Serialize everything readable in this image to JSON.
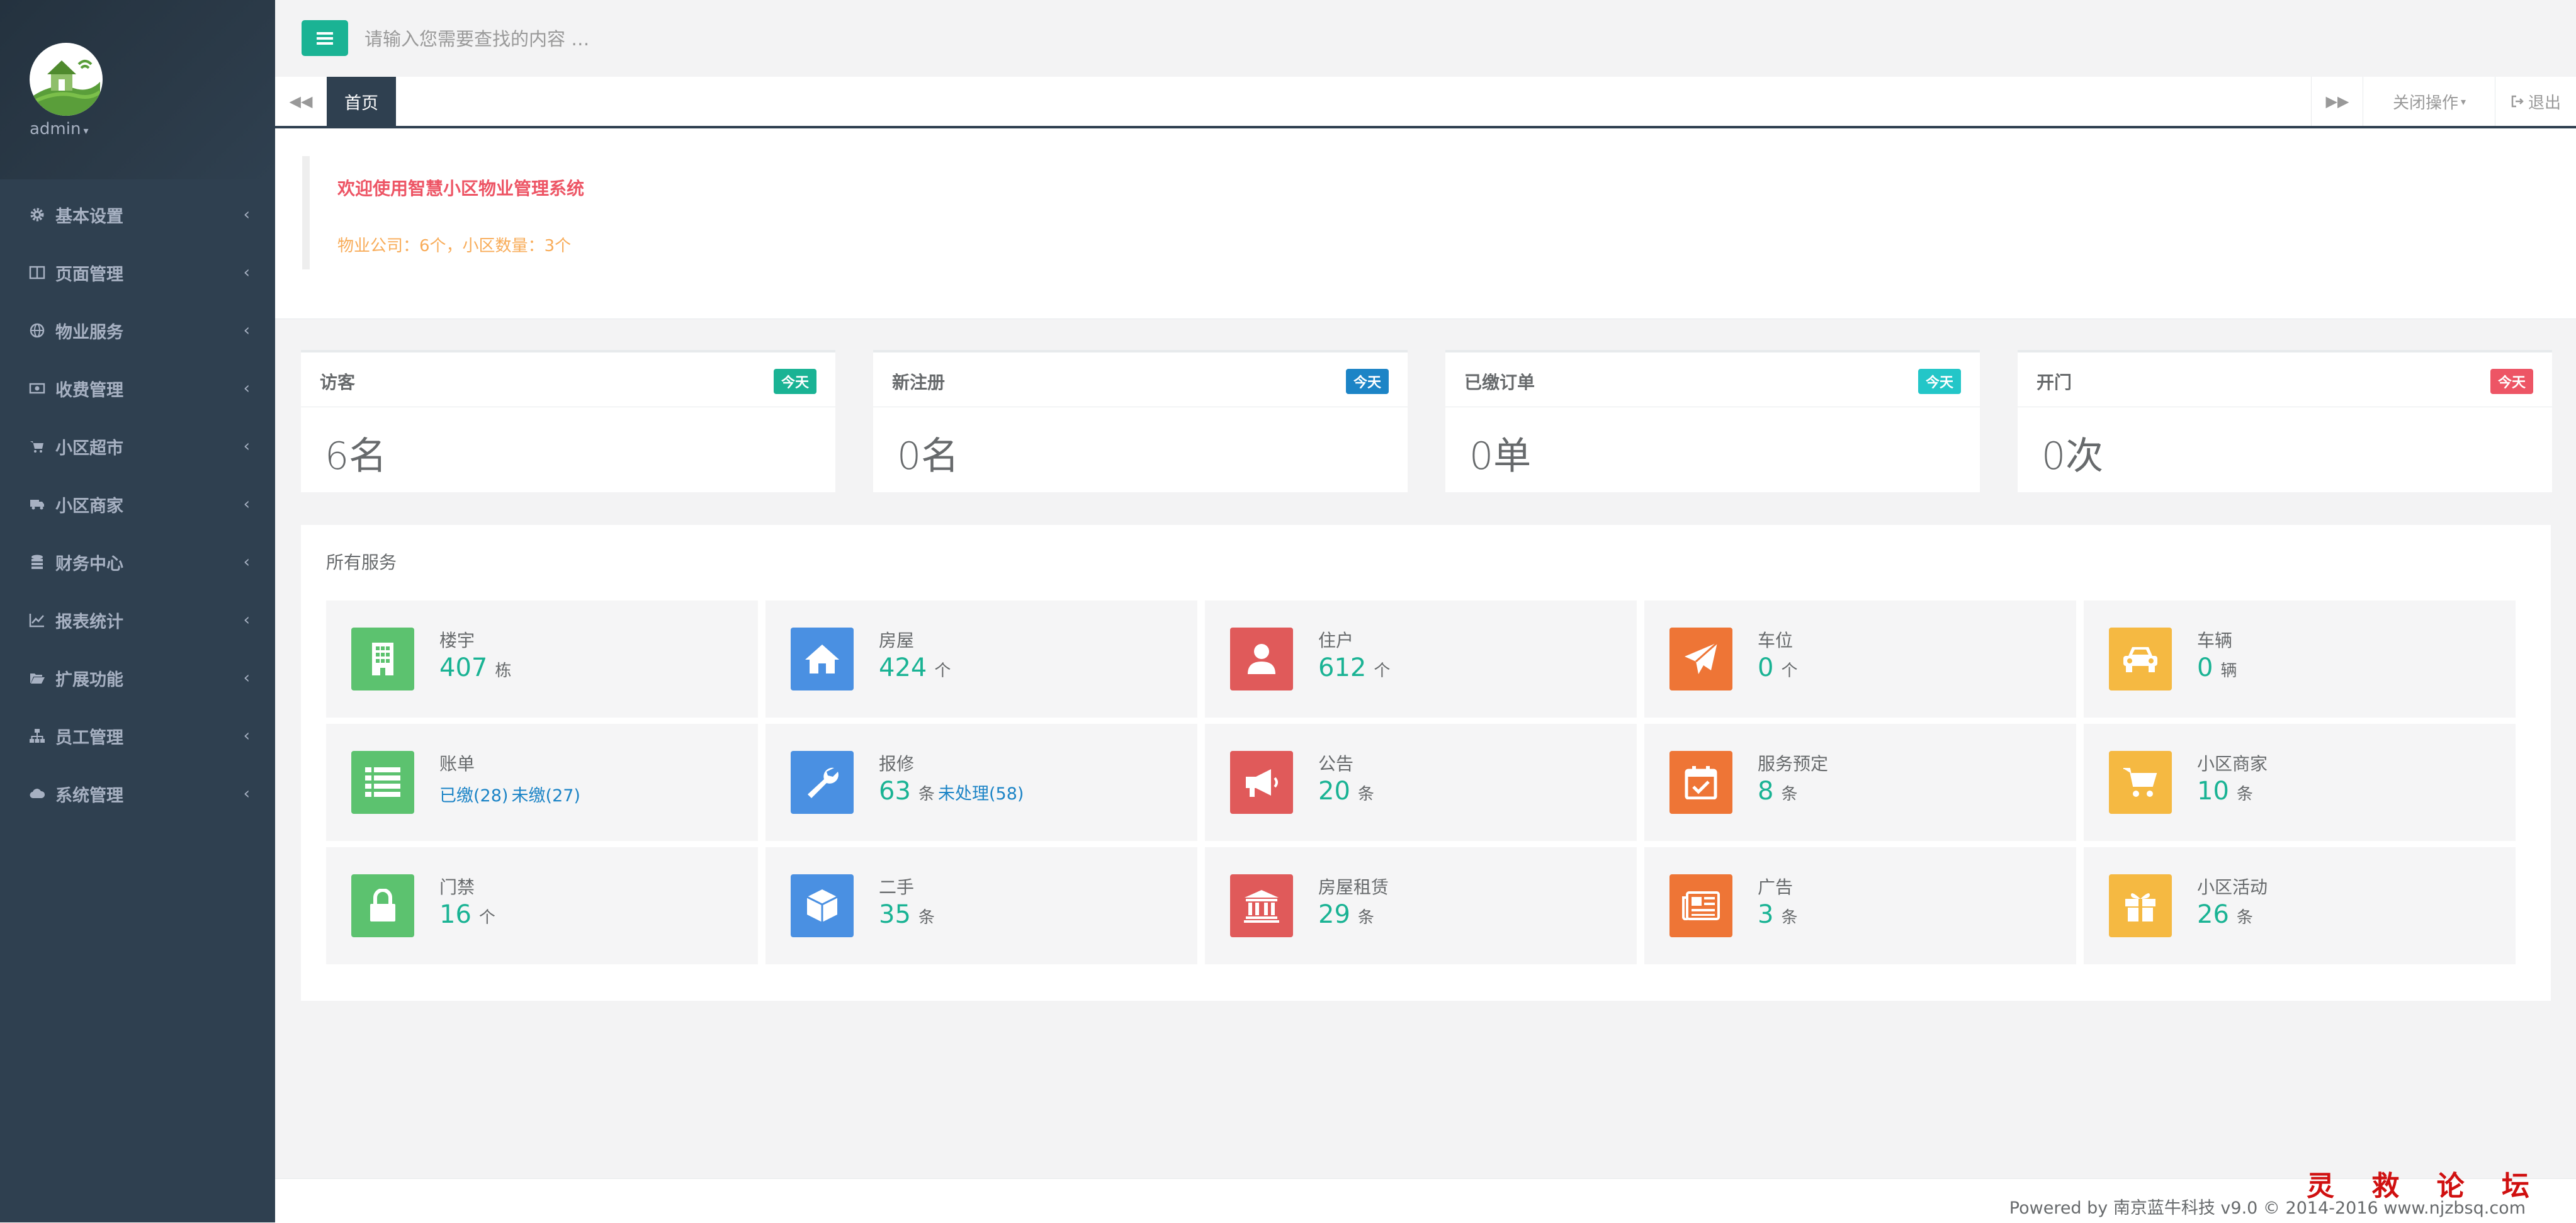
{
  "user": {
    "name": "admin"
  },
  "sidebar": {
    "items": [
      {
        "label": "基本设置",
        "icon": "gear-icon"
      },
      {
        "label": "页面管理",
        "icon": "columns-icon"
      },
      {
        "label": "物业服务",
        "icon": "globe-icon"
      },
      {
        "label": "收费管理",
        "icon": "money-icon"
      },
      {
        "label": "小区超市",
        "icon": "shopping-cart-icon"
      },
      {
        "label": "小区商家",
        "icon": "truck-icon"
      },
      {
        "label": "财务中心",
        "icon": "database-icon"
      },
      {
        "label": "报表统计",
        "icon": "line-chart-icon"
      },
      {
        "label": "扩展功能",
        "icon": "folder-open-icon"
      },
      {
        "label": "员工管理",
        "icon": "sitemap-icon"
      },
      {
        "label": "系统管理",
        "icon": "cloud-icon"
      }
    ]
  },
  "search": {
    "placeholder": "请输入您需要查找的内容 …"
  },
  "tabs": {
    "home": "首页",
    "close_ops": "关闭操作",
    "logout": "退出"
  },
  "welcome": {
    "title": "欢迎使用智慧小区物业管理系统",
    "stats": "物业公司：6个，小区数量：3个"
  },
  "cards": [
    {
      "title": "访客",
      "badge": "今天",
      "value": "6名",
      "color": "#1ab394"
    },
    {
      "title": "新注册",
      "badge": "今天",
      "value": "0名",
      "color": "#1c84c6"
    },
    {
      "title": "已缴订单",
      "badge": "今天",
      "value": "0单",
      "color": "#23c6c8"
    },
    {
      "title": "开门",
      "badge": "今天",
      "value": "0次",
      "color": "#ed5565"
    }
  ],
  "services": {
    "title": "所有服务",
    "tiles": [
      {
        "label": "楼宇",
        "value": "407",
        "unit": "栋",
        "icon": "building-icon",
        "color": "#5cc26f"
      },
      {
        "label": "房屋",
        "value": "424",
        "unit": "个",
        "icon": "home-icon",
        "color": "#4a90e2"
      },
      {
        "label": "住户",
        "value": "612",
        "unit": "个",
        "icon": "user-icon",
        "color": "#e05a5a"
      },
      {
        "label": "车位",
        "value": "0",
        "unit": "个",
        "icon": "paper-plane-icon",
        "color": "#ee7536"
      },
      {
        "label": "车辆",
        "value": "0",
        "unit": "辆",
        "icon": "car-icon",
        "color": "#f5b942"
      },
      {
        "label": "账单",
        "paid": "已缴(28)",
        "unpaid": "未缴(27)",
        "icon": "list-icon",
        "color": "#5cc26f"
      },
      {
        "label": "报修",
        "value": "63",
        "unit": "条",
        "pending": "未处理(58)",
        "icon": "wrench-icon",
        "color": "#4a90e2"
      },
      {
        "label": "公告",
        "value": "20",
        "unit": "条",
        "icon": "bullhorn-icon",
        "color": "#e05a5a"
      },
      {
        "label": "服务预定",
        "value": "8",
        "unit": "条",
        "icon": "calendar-check-icon",
        "color": "#ee7536"
      },
      {
        "label": "小区商家",
        "value": "10",
        "unit": "条",
        "icon": "cart-icon",
        "color": "#f5b942"
      },
      {
        "label": "门禁",
        "value": "16",
        "unit": "个",
        "icon": "lock-icon",
        "color": "#5cc26f"
      },
      {
        "label": "二手",
        "value": "35",
        "unit": "条",
        "icon": "cube-icon",
        "color": "#4a90e2"
      },
      {
        "label": "房屋租赁",
        "value": "29",
        "unit": "条",
        "icon": "bank-icon",
        "color": "#e05a5a"
      },
      {
        "label": "广告",
        "value": "3",
        "unit": "条",
        "icon": "newspaper-icon",
        "color": "#ee7536"
      },
      {
        "label": "小区活动",
        "value": "26",
        "unit": "条",
        "icon": "gift-icon",
        "color": "#f5b942"
      }
    ]
  },
  "footer": {
    "text": "Powered by 南京蓝牛科技 v9.0 © 2014-2016 www.njzbsq.com"
  },
  "watermark": "灵 救 论 坛"
}
